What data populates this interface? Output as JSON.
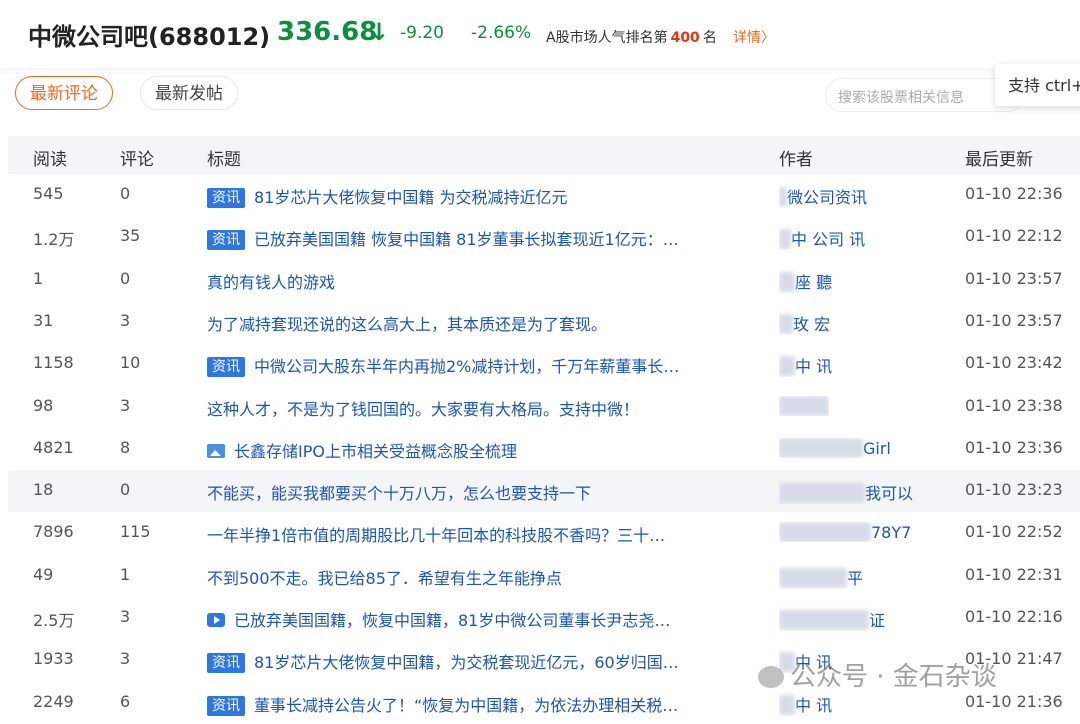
{
  "header": {
    "stock_name": "中微公司吧(688012)",
    "price": "336.68",
    "arrow": "↓",
    "change": "-9.20",
    "change_pct": "-2.66%",
    "rank_prefix": "A股市场人气排名第",
    "rank_value": "400",
    "rank_suffix": "名",
    "detail_link": "详情〉",
    "price_color": "#0a8f3b"
  },
  "tabs": [
    {
      "label": "最新评论",
      "active": true
    },
    {
      "label": "最新发帖",
      "active": false
    }
  ],
  "search": {
    "placeholder": "搜索该股票相关信息"
  },
  "tooltip": {
    "text": "支持 ctrl+"
  },
  "table": {
    "headers": {
      "read": "阅读",
      "comments": "评论",
      "title": "标题",
      "author": "作者",
      "updated": "最后更新"
    },
    "rows": [
      {
        "read": "545",
        "comments": "0",
        "tag": "资讯",
        "title": "81岁芯片大佬恢复中国籍 为交税减持近亿元",
        "author": "微公司资讯",
        "time": "01-10 22:36"
      },
      {
        "read": "1.2万",
        "comments": "35",
        "tag": "资讯",
        "title": "已放弃美国国籍 恢复中国籍 81岁董事长拟套现近1亿元：…",
        "author": "中  公司  讯",
        "time": "01-10 22:12"
      },
      {
        "read": "1",
        "comments": "0",
        "tag": "",
        "title": "真的有钱人的游戏",
        "author": "座  聽",
        "time": "01-10 23:57"
      },
      {
        "read": "31",
        "comments": "3",
        "tag": "",
        "title": "为了减持套现还说的这么高大上，其本质还是为了套现。",
        "author": "玫  宏",
        "time": "01-10 23:57"
      },
      {
        "read": "1158",
        "comments": "10",
        "tag": "资讯",
        "title": "中微公司大股东半年内再抛2%减持计划，千万年薪董事长…",
        "author": "中  讯",
        "time": "01-10 23:42"
      },
      {
        "read": "98",
        "comments": "3",
        "tag": "",
        "title": "这种人才，不是为了钱回国的。大家要有大格局。支持中微！",
        "author": "",
        "time": "01-10 23:38"
      },
      {
        "read": "4821",
        "comments": "8",
        "tag": "",
        "icon": "image-icon",
        "title": "长鑫存储IPO上市相关受益概念股全梳理",
        "author": "Girl",
        "time": "01-10 23:36"
      },
      {
        "read": "18",
        "comments": "0",
        "tag": "",
        "title": "不能买，能买我都要买个十万八万，怎么也要支持一下",
        "author": "我可以",
        "time": "01-10 23:23"
      },
      {
        "read": "7896",
        "comments": "115",
        "tag": "",
        "title": "一年半挣1倍市值的周期股比几十年回本的科技股不香吗？三十…",
        "author": "78Y7",
        "time": "01-10 22:52"
      },
      {
        "read": "49",
        "comments": "1",
        "tag": "",
        "title": "不到500不走。我已给85了．希望有生之年能挣点",
        "author": "平",
        "time": "01-10 22:31"
      },
      {
        "read": "2.5万",
        "comments": "3",
        "tag": "",
        "icon": "video-icon",
        "title": "已放弃美国国籍，恢复中国籍，81岁中微公司董事长尹志尧…",
        "author": "证",
        "time": "01-10 22:16"
      },
      {
        "read": "1933",
        "comments": "3",
        "tag": "资讯",
        "title": "81岁芯片大佬恢复中国籍，为交税套现近亿元，60岁归国…",
        "author": "中  讯",
        "time": "01-10 21:47"
      },
      {
        "read": "2249",
        "comments": "6",
        "tag": "资讯",
        "title": "董事长减持公告火了！“恢复为中国籍，为依法办理相关税…",
        "author": "中  讯",
        "time": "01-10 21:36"
      }
    ]
  },
  "watermark": {
    "text": "公众号 · 金石杂谈"
  }
}
